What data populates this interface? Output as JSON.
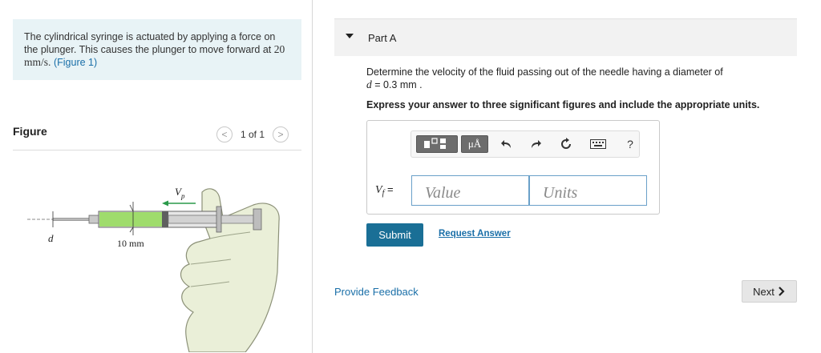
{
  "problem": {
    "text_before": "The cylindrical syringe is actuated by applying a force on the plunger. This causes the plunger to move forward at ",
    "speed": "20 mm/s",
    "text_after": ". ",
    "figure_link": "(Figure 1)"
  },
  "figure": {
    "heading": "Figure",
    "pager": {
      "prev": "<",
      "count": "1 of 1",
      "next": ">"
    },
    "label_vp": "V",
    "label_vp_sub": "p",
    "label_d": "d",
    "label_10mm": "10 mm"
  },
  "part": {
    "title": "Part A"
  },
  "question": {
    "line1": "Determine the velocity of the fluid passing out of the needle having a diameter of",
    "line2_var": "d",
    "line2_rest": " = 0.3  mm .",
    "instruction": "Express your answer to three significant figures and include the appropriate units."
  },
  "answer": {
    "var_label": "V",
    "var_sub": "f",
    "equals": " =",
    "value_placeholder": "Value",
    "units_placeholder": "Units",
    "toolbar": {
      "units_btn": "μÅ",
      "help": "?"
    }
  },
  "buttons": {
    "submit": "Submit",
    "request_answer": "Request Answer",
    "provide_feedback": "Provide Feedback",
    "next": "Next"
  },
  "colors": {
    "accent": "#1a6f96",
    "problem_bg": "#e8f3f6",
    "link": "#1a6fa8",
    "syringe_fluid": "#9fdc6c"
  }
}
